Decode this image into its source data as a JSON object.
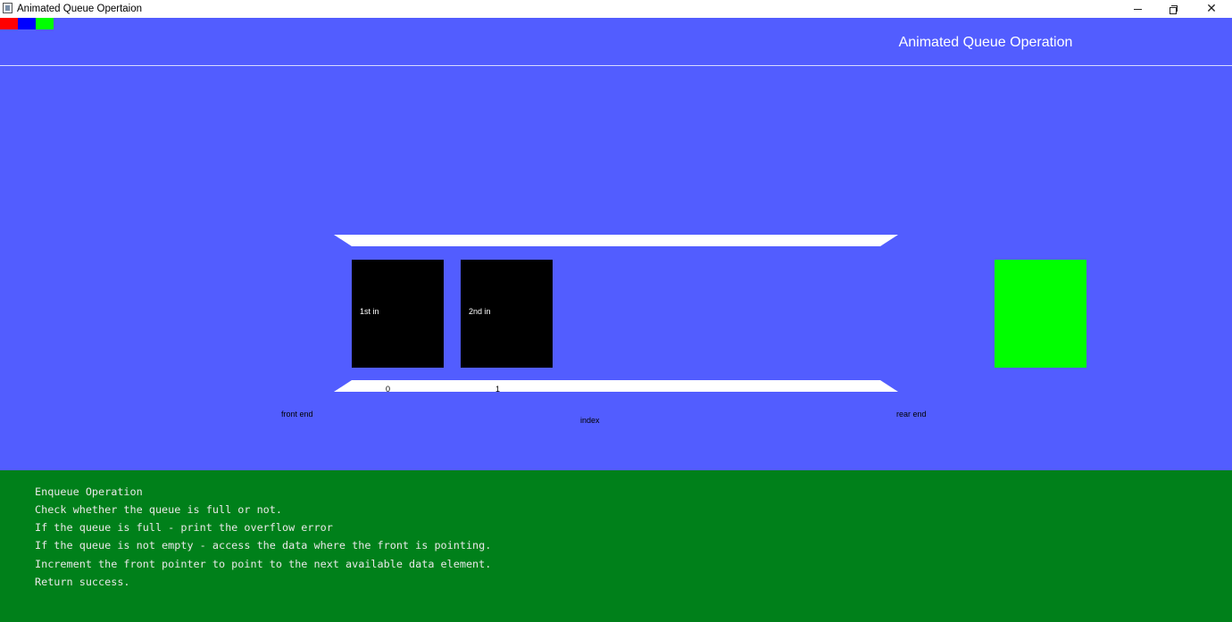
{
  "window": {
    "title": "Animated Queue Opertaion",
    "controls": [
      "minimize",
      "restore",
      "close"
    ],
    "close_glyph": "✕"
  },
  "palette": {
    "swatches": [
      {
        "name": "red",
        "color": "#ff0000"
      },
      {
        "name": "blue",
        "color": "#0000ff"
      },
      {
        "name": "green",
        "color": "#00ff00"
      }
    ]
  },
  "canvas": {
    "background": "#525dff",
    "heading": "Animated Queue Operation",
    "queue": {
      "elements": [
        {
          "label": "1st in",
          "index": "0"
        },
        {
          "label": "2nd in",
          "index": "1"
        }
      ],
      "incoming_color": "#00ff00",
      "front_label": "front end",
      "index_label": "index",
      "rear_label": "rear end"
    }
  },
  "info": {
    "background": "#00801a",
    "lines": [
      "Enqueue Operation",
      "Check whether the queue is full or not.",
      "If the queue is full - print the overflow error",
      "If the queue is not empty - access the data where the front is pointing.",
      "Increment the front pointer to point to the next available data element.",
      "Return success."
    ]
  }
}
